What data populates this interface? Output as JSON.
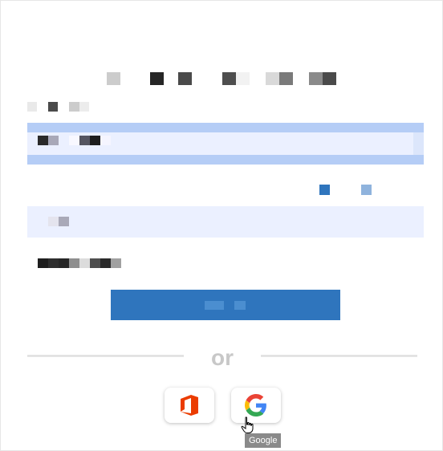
{
  "colors": {
    "primary": "#2f75bd",
    "input_bg": "#ebf0ff",
    "focus_bar": "#b5cdf6",
    "office_orange": "#eb3c00"
  },
  "divider": {
    "text": "or"
  },
  "social": {
    "office_icon": "office-logo",
    "google_icon": "google-logo",
    "tooltip": "Google"
  }
}
